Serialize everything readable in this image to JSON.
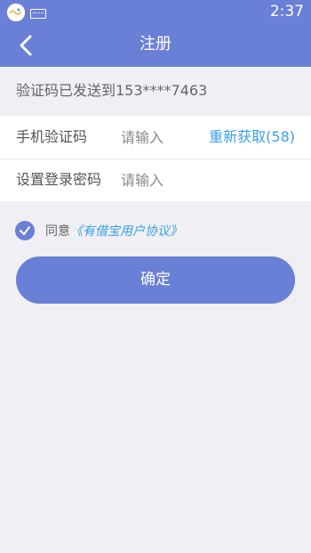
{
  "status_bar": {
    "time": "2:37"
  },
  "nav": {
    "title": "注册"
  },
  "notice": "验证码已发送到153****7463",
  "form": {
    "code": {
      "label": "手机验证码",
      "placeholder": "请输入",
      "resend": "重新获取(58)"
    },
    "password": {
      "label": "设置登录密码",
      "placeholder": "请输入"
    }
  },
  "agreement": {
    "prefix": "同意",
    "link": "《有借宝用户协议》",
    "checked": true
  },
  "confirm_label": "确定",
  "colors": {
    "primary": "#6a7fd6",
    "link": "#3aa0e6",
    "background": "#efeff4"
  },
  "icons": [
    "app-logo-icon",
    "keyboard-icon",
    "back-arrow-icon",
    "checkmark-icon"
  ]
}
